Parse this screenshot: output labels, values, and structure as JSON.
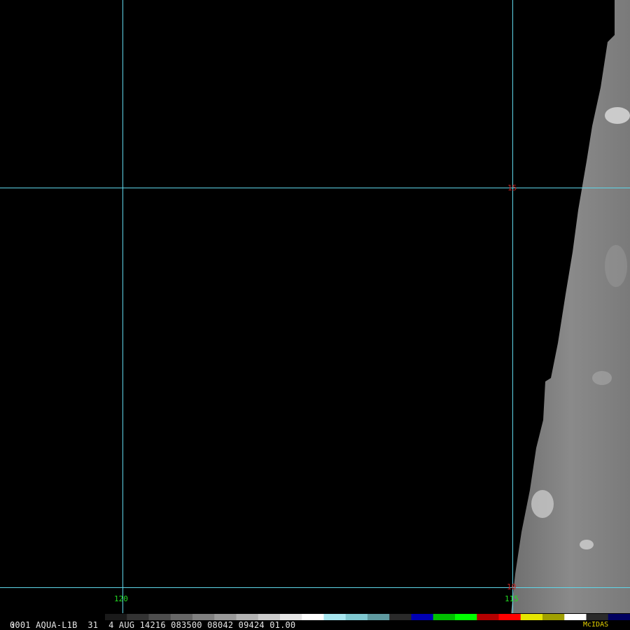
{
  "image": {
    "satellite_sensor": "AQUA-L1B",
    "frame": "0001",
    "frame_marker": "1",
    "band": "31",
    "day": "4",
    "month": "AUG",
    "julian": "14216",
    "time": "083500",
    "line_info": "08042",
    "elem_info": "09424",
    "resolution": "01.00"
  },
  "grid": {
    "latitude_labels": [
      "15",
      "10"
    ],
    "longitude_labels": [
      "120",
      "115"
    ]
  },
  "status": {
    "text": "0001 AQUA-L1B  31  4 AUG 14216 083500 08042 09424 01.00",
    "brand": "McIDAS"
  },
  "colors": {
    "grid_line": "#5fd7ea",
    "latitude_label": "#c81e1e",
    "longitude_label": "#22dd22",
    "brand": "#e6d200",
    "colorbar_segments": [
      "#1a1a1a",
      "#333333",
      "#4d4d4d",
      "#666666",
      "#808080",
      "#999999",
      "#b3b3b3",
      "#cccccc",
      "#e6e6e6",
      "#ffffff",
      "#a8e6ef",
      "#7fc8d0",
      "#5f9aa0",
      "#2a2a2a",
      "#0000b4",
      "#00c000",
      "#00ff00",
      "#b40000",
      "#ff0000",
      "#e6e600",
      "#a0a000",
      "#ffffff",
      "#2a2a2a",
      "#000060"
    ]
  }
}
